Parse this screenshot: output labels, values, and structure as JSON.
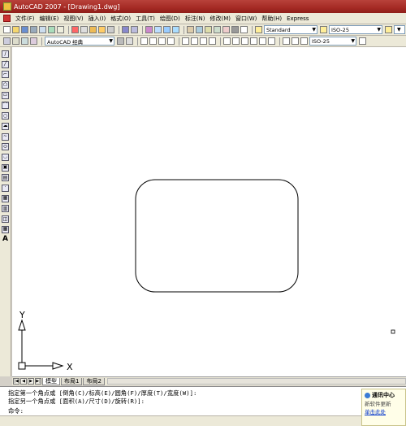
{
  "window": {
    "title": "AutoCAD 2007 - [Drawing1.dwg]"
  },
  "menu": {
    "items": [
      "文件(F)",
      "编辑(E)",
      "视图(V)",
      "插入(I)",
      "格式(O)",
      "工具(T)",
      "绘图(D)",
      "标注(N)",
      "修改(M)",
      "窗口(W)",
      "帮助(H)",
      "Express"
    ]
  },
  "toolbar_top": {
    "text_style": "Standard",
    "dim_style": "ISO-25"
  },
  "toolbar_second": {
    "workspace": "AutoCAD 经典",
    "dim_style": "ISO-25"
  },
  "left_toolbar": {
    "text_tool": "A"
  },
  "ucs": {
    "x_label": "X",
    "y_label": "Y"
  },
  "layout_tabs": {
    "model": "模型",
    "layout1": "布局1",
    "layout2": "布局2"
  },
  "command": {
    "line1": "指定第一个角点或 [倒角(C)/标高(E)/圆角(F)/厚度(T)/宽度(W)]:",
    "line2": "指定另一个角点或 [面积(A)/尺寸(D)/旋转(R)]:",
    "prompt": "命令:"
  },
  "notification": {
    "title": "通讯中心",
    "body": "新软件更新",
    "link": "单击此处"
  },
  "colors": {
    "titlebar": "#a52a24",
    "canvas": "#ffffff",
    "drawing_line": "#000000"
  }
}
